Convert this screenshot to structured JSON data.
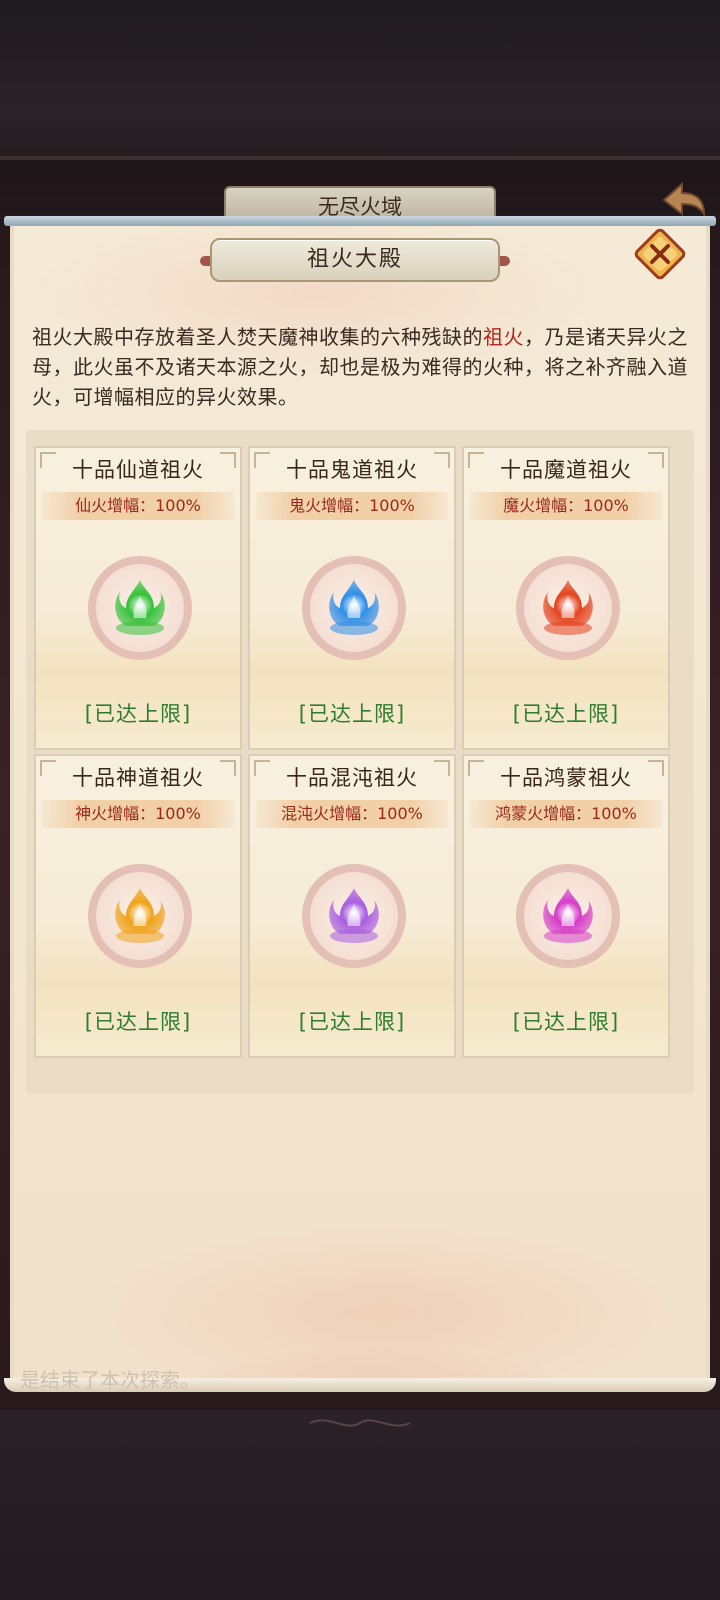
{
  "background": {
    "previous_title": "无尽火域",
    "log_text": "是结束了本次探索。"
  },
  "dialog": {
    "title": "祖火大殿",
    "description_pre": "祖火大殿中存放着圣人焚天魔神收集的六种残缺的",
    "description_highlight": "祖火",
    "description_post": "，乃是诸天异火之母，此火虽不及诸天本源之火，却也是极为难得的火种，将之补齐融入道火，可增幅相应的异火效果。"
  },
  "fires": [
    {
      "name": "十品仙道祖火",
      "boost": "仙火增幅：100%",
      "status": "[已达上限]",
      "color": "#35c23a",
      "icon": "green-flame-icon"
    },
    {
      "name": "十品鬼道祖火",
      "boost": "鬼火增幅：100%",
      "status": "[已达上限]",
      "color": "#2f8fe8",
      "icon": "blue-flame-icon"
    },
    {
      "name": "十品魔道祖火",
      "boost": "魔火增幅：100%",
      "status": "[已达上限]",
      "color": "#e4431f",
      "icon": "red-flame-icon"
    },
    {
      "name": "十品神道祖火",
      "boost": "神火增幅：100%",
      "status": "[已达上限]",
      "color": "#f0a21a",
      "icon": "gold-flame-icon"
    },
    {
      "name": "十品混沌祖火",
      "boost": "混沌火增幅：100%",
      "status": "[已达上限]",
      "color": "#a85de0",
      "icon": "purple-blue-flame-icon"
    },
    {
      "name": "十品鸿蒙祖火",
      "boost": "鸿蒙火增幅：100%",
      "status": "[已达上限]",
      "color": "#d63cc8",
      "icon": "magenta-flame-icon"
    }
  ]
}
